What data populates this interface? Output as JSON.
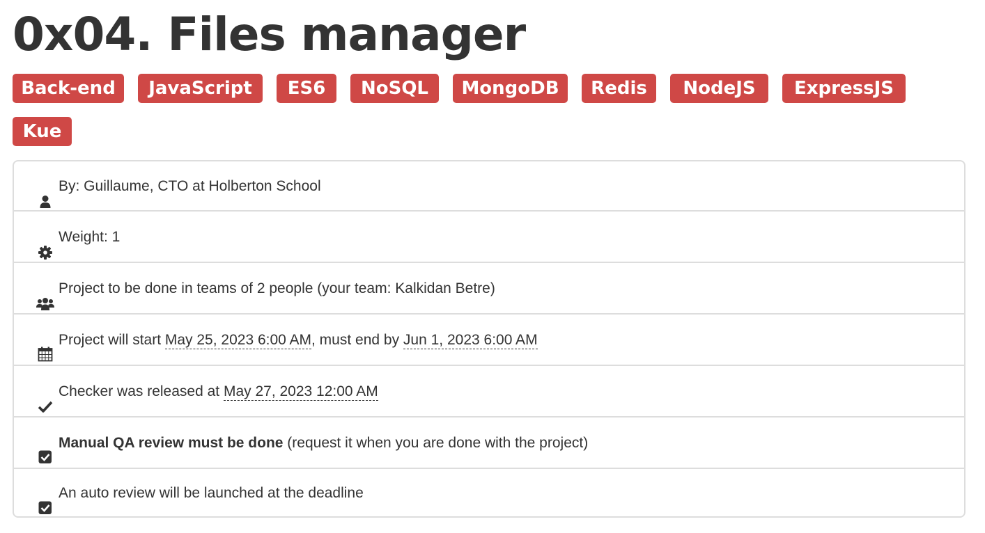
{
  "page": {
    "title": "0x04. Files manager"
  },
  "tags": [
    "Back-end",
    "JavaScript",
    "ES6",
    "NoSQL",
    "MongoDB",
    "Redis",
    "NodeJS",
    "ExpressJS",
    "Kue"
  ],
  "info": {
    "author": {
      "icon": "user-icon",
      "text": "By: Guillaume, CTO at Holberton School"
    },
    "weight": {
      "icon": "gear-icon",
      "text": "Weight: 1"
    },
    "team": {
      "icon": "users-icon",
      "text": "Project to be done in teams of 2 people (your team: Kalkidan Betre)"
    },
    "schedule": {
      "icon": "calendar-icon",
      "prefix": "Project will start ",
      "start_date": "May 25, 2023 6:00 AM",
      "middle": ", must end by ",
      "end_date": "Jun 1, 2023 6:00 AM"
    },
    "checker": {
      "icon": "check-icon",
      "prefix": "Checker was released at ",
      "date": "May 27, 2023 12:00 AM"
    },
    "manual_qa": {
      "icon": "checked-box-icon",
      "bold": "Manual QA review must be done",
      "rest": " (request it when you are done with the project)"
    },
    "auto_review": {
      "icon": "checked-box-icon",
      "text": "An auto review will be launched at the deadline"
    }
  },
  "colors": {
    "tag_background": "#cf4846",
    "tag_text": "#ffffff",
    "text": "#333333",
    "border": "#dddddd"
  }
}
